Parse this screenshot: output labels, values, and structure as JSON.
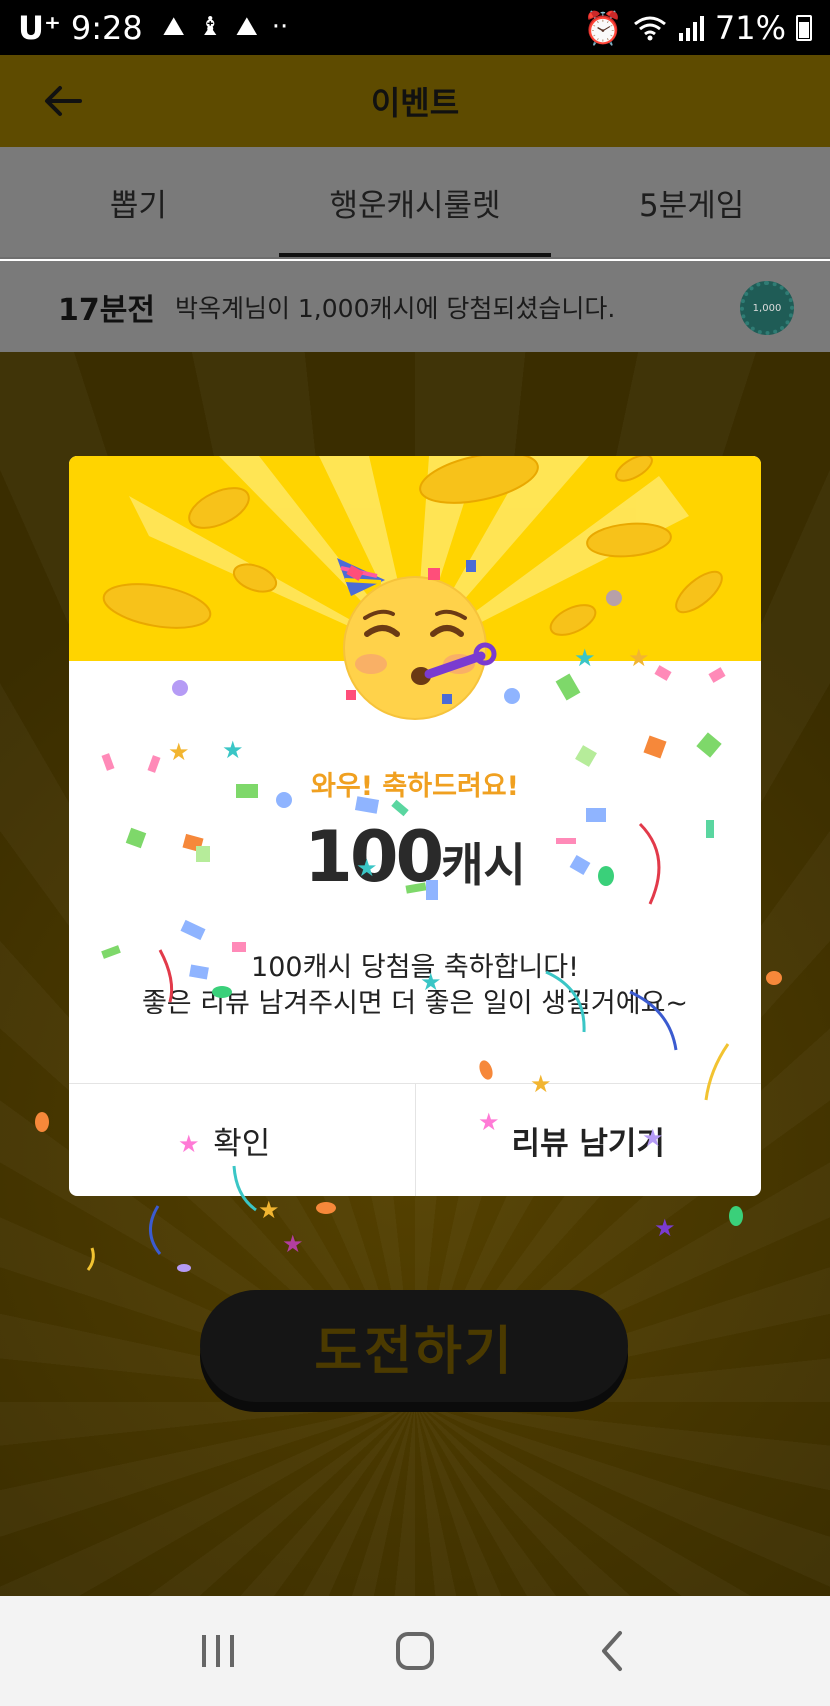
{
  "status_bar": {
    "carrier": "U⁺",
    "time": "9:28",
    "notification_icons": [
      "mountain-icon",
      "runner-icon",
      "mountain-icon"
    ],
    "overflow": "··",
    "battery": "71%"
  },
  "header": {
    "title": "이벤트"
  },
  "tabs": [
    {
      "label": "뽑기",
      "active": false
    },
    {
      "label": "행운캐시룰렛",
      "active": true
    },
    {
      "label": "5분게임",
      "active": false
    }
  ],
  "ticker": {
    "time_ago": "17분전",
    "message": "박옥계님이 1,000캐시에 당첨되셨습니다.",
    "badge_value": "1,000",
    "badge_unit": "캐시"
  },
  "main": {
    "challenge_button": "도전하기"
  },
  "modal": {
    "wow": "와우! 축하드려요!",
    "amount": "100",
    "unit": "캐시",
    "message_line1": "100캐시 당첨을 축하합니다!",
    "message_line2": "좋은 리뷰 남겨주시면 더 좋은 일이 생길거에요~",
    "confirm_label": "확인",
    "review_label": "리뷰 남기기"
  },
  "colors": {
    "banner_yellow": "#ffd400",
    "wow_orange": "#f0a020"
  }
}
